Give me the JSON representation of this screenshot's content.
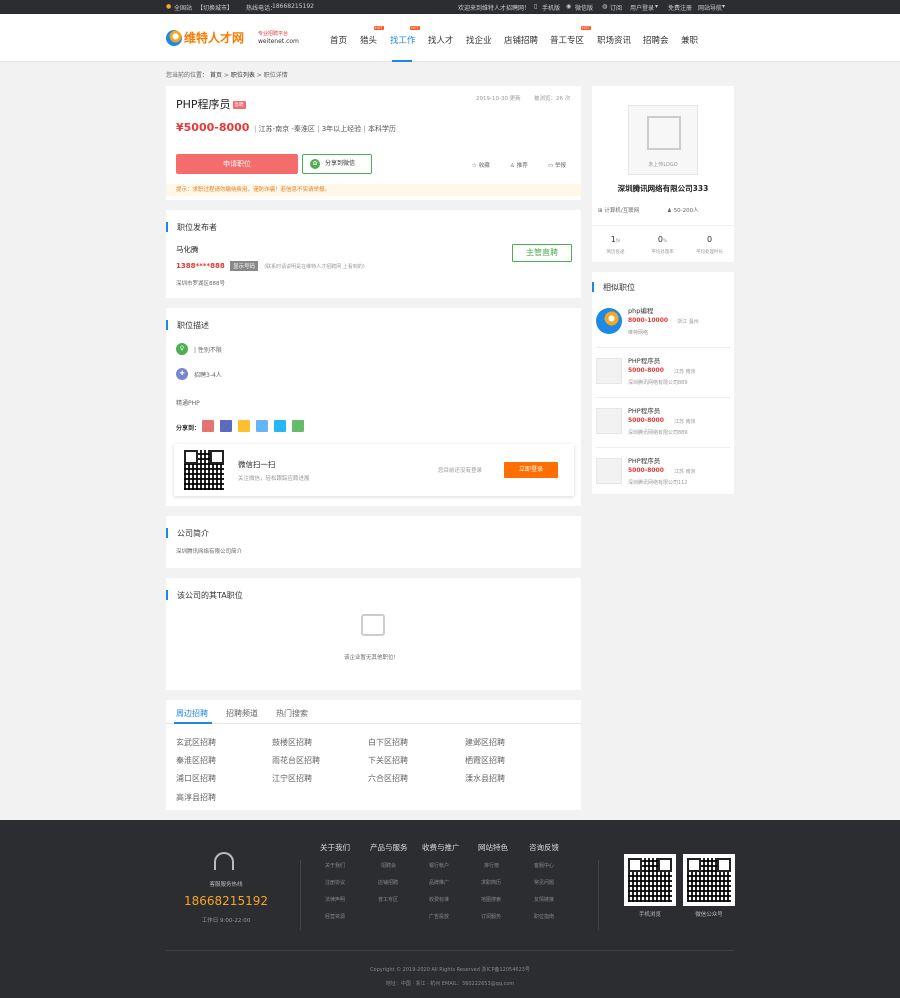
{
  "topbar": {
    "site": "全国站",
    "switch": "【切换城市】",
    "hotline_label": "热线电话：",
    "hotline": "18668215192",
    "welcome": "欢迎来到维特人才招聘网！",
    "mobile": "手机版",
    "wechat": "微信版",
    "subscribe": "订阅",
    "user_login": "用户登录",
    "register": "免费注册",
    "sitemap": "网站导航"
  },
  "header": {
    "logo_main": "维特人才网",
    "logo_slogan": "专业招聘平台",
    "logo_domain": "weitenet.com",
    "hot": "HOT",
    "nav": [
      "首页",
      "猎头",
      "找工作",
      "找人才",
      "找企业",
      "店铺招聘",
      "普工专区",
      "职场资讯",
      "招聘会",
      "兼职"
    ]
  },
  "breadcrumb": {
    "prefix": "您当前的位置：",
    "home": "首页",
    "list": "职位列表",
    "current": "职位详情",
    "sep": ">"
  },
  "job": {
    "title": "PHP程序员",
    "urgent": "急聘",
    "date": "2019-10-30 更新",
    "views": "被浏览：26 次",
    "salary": "¥5000-8000",
    "location": "江苏-南京 -秦淮区",
    "experience": "3年以上经验",
    "education": "本科学历",
    "apply": "申请职位",
    "share_wechat": "分享到微信",
    "collect": "收藏",
    "recommend": "推荐",
    "report": "举报",
    "tip": "提示：求职过程请勿缴纳费用，谨防诈骗！若信息不实请举报。"
  },
  "publisher": {
    "title": "职位发布者",
    "name": "马化腾",
    "phone": "1388****888",
    "show_phone": "显示号码",
    "phone_note": "(联系时请说明是在维特人才招聘网 上看到的)",
    "address": "深圳市罗湖区888号",
    "live": "主管直聘"
  },
  "desc": {
    "title": "职位描述",
    "gender": "| 性别不限",
    "headcount": "招聘3-4人",
    "content": "精通PHP",
    "share_label": "分享到：",
    "scan_title": "微信扫一扫",
    "scan_sub": "关注微信，轻松跟踪应聘进展",
    "not_logged": "您目前还没有登录",
    "login_btn": "立即登录"
  },
  "company_intro": {
    "title": "公司简介",
    "text": "深圳腾讯网络有限公司简介"
  },
  "other_jobs": {
    "title": "该公司的其TA职位",
    "empty": "该企业暂无其他职位!"
  },
  "tabs": {
    "items": [
      "周边招聘",
      "招聘频道",
      "热门搜索"
    ],
    "areas": [
      "玄武区招聘",
      "鼓楼区招聘",
      "白下区招聘",
      "建邺区招聘",
      "秦淮区招聘",
      "雨花台区招聘",
      "下关区招聘",
      "栖霞区招聘",
      "浦口区招聘",
      "江宁区招聘",
      "六合区招聘",
      "溧水县招聘",
      "高淳县招聘"
    ]
  },
  "company": {
    "logo_text": "未上传LOGO",
    "name": "深圳腾讯网络有限公司333",
    "industry": "计算机/互联网",
    "size": "50-200人",
    "stats": [
      {
        "value": "1",
        "unit": "份",
        "label": "简历投递"
      },
      {
        "value": "0",
        "unit": "%",
        "label": "平均处理率"
      },
      {
        "value": "0",
        "unit": "",
        "label": "平均处理时长"
      }
    ]
  },
  "similar": {
    "title": "相似职位",
    "items": [
      {
        "title": "php编程",
        "salary": "8000-10000",
        "city": "浙江 温州",
        "company": "维特网络"
      },
      {
        "title": "PHP程序员",
        "salary": "5000-8000",
        "city": "江苏 南京",
        "company": "深圳腾讯网络有限公司889"
      },
      {
        "title": "PHP程序员",
        "salary": "5000-8000",
        "city": "江苏 南京",
        "company": "深圳腾讯网络有限公司889"
      },
      {
        "title": "PHP程序员",
        "salary": "5000-8000",
        "city": "江苏 南京",
        "company": "深圳腾讯网络有限公司112"
      }
    ]
  },
  "footer": {
    "service_label": "客服服务热线",
    "hotline": "18668215192",
    "hours": "工作日 9:00-22:00",
    "cols": [
      {
        "h": "关于我们",
        "items": [
          "关于我们",
          "注册协议",
          "法律声明",
          "经营资源"
        ]
      },
      {
        "h": "产品与服务",
        "items": [
          "招聘会",
          "店铺招聘",
          "普工专区"
        ]
      },
      {
        "h": "收费与推广",
        "items": [
          "银行帐户",
          "品牌推广",
          "收费标准",
          "广告投放"
        ]
      },
      {
        "h": "网站特色",
        "items": [
          "排行榜",
          "求职简历",
          "地图搜索",
          "订阅服务"
        ]
      },
      {
        "h": "咨询反馈",
        "items": [
          "客服中心",
          "常见问题",
          "友情链接",
          "职位指南"
        ]
      }
    ],
    "qr1": "手机浏览",
    "qr2": "微信公众号",
    "copyright": "Copyright © 2019-2020 All Rights Reserved 浙ICP备12054623号",
    "address": "地址：中国 · 浙江 · 杭州 EMAIL：360222653@qq.com"
  }
}
